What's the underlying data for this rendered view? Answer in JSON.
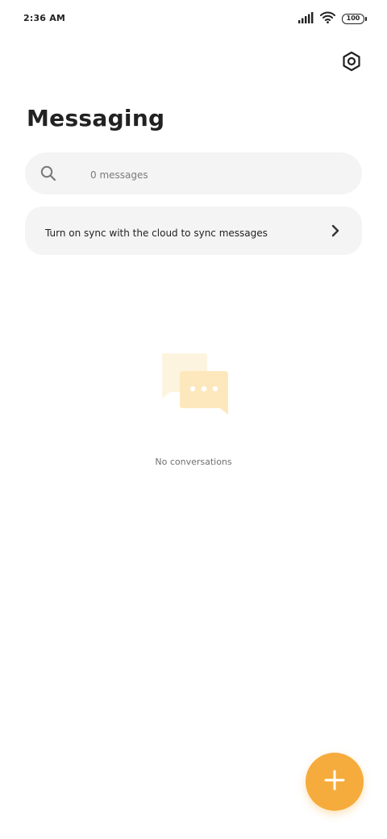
{
  "status_bar": {
    "time": "2:36 AM",
    "battery": "100"
  },
  "header": {
    "title": "Messaging"
  },
  "search": {
    "placeholder": "0 messages"
  },
  "sync_banner": {
    "text": "Turn on sync with the cloud to sync messages"
  },
  "empty_state": {
    "text": "No conversations"
  },
  "icons": {
    "settings": "settings-hexagon-icon",
    "search": "search-icon",
    "chevron": "chevron-right-icon",
    "add": "plus-icon",
    "signal": "signal-icon",
    "wifi": "wifi-icon"
  },
  "colors": {
    "accent": "#f5ac3c",
    "card_background": "#f4f4f4",
    "illustration": "#fdedc9"
  }
}
